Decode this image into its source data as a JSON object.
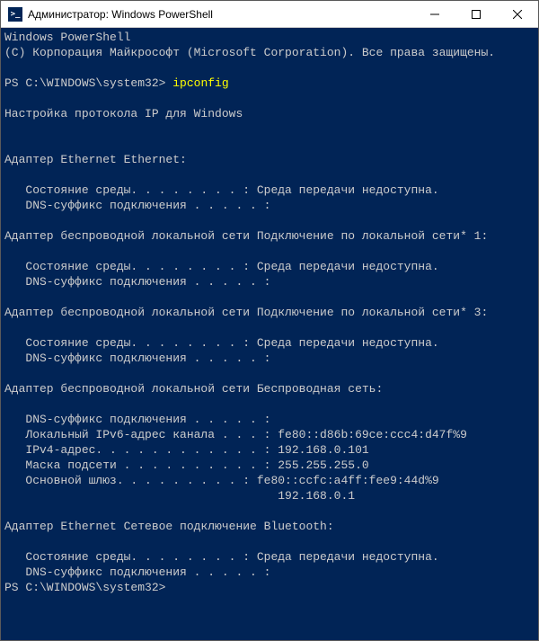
{
  "titlebar": {
    "icon_glyph": ">_",
    "title": "Администратор: Windows PowerShell",
    "minimize_label": "Minimize",
    "maximize_label": "Maximize",
    "close_label": "Close"
  },
  "terminal": {
    "header1": "Windows PowerShell",
    "header2": "(С) Корпорация Майкрософт (Microsoft Corporation). Все права защищены.",
    "prompt_prefix": "PS C:\\WINDOWS\\system32>",
    "command": "ipconfig",
    "config_title": "Настройка протокола IP для Windows",
    "adapters": [
      {
        "name": "Адаптер Ethernet Ethernet:",
        "rows": [
          {
            "label": "   Состояние среды. . . . . . . . :",
            "value": " Среда передачи недоступна."
          },
          {
            "label": "   DNS-суффикс подключения . . . . . :",
            "value": ""
          }
        ]
      },
      {
        "name": "Адаптер беспроводной локальной сети Подключение по локальной сети* 1:",
        "rows": [
          {
            "label": "   Состояние среды. . . . . . . . :",
            "value": " Среда передачи недоступна."
          },
          {
            "label": "   DNS-суффикс подключения . . . . . :",
            "value": ""
          }
        ]
      },
      {
        "name": "Адаптер беспроводной локальной сети Подключение по локальной сети* 3:",
        "rows": [
          {
            "label": "   Состояние среды. . . . . . . . :",
            "value": " Среда передачи недоступна."
          },
          {
            "label": "   DNS-суффикс подключения . . . . . :",
            "value": ""
          }
        ]
      },
      {
        "name": "Адаптер беспроводной локальной сети Беспроводная сеть:",
        "rows": [
          {
            "label": "   DNS-суффикс подключения . . . . . :",
            "value": ""
          },
          {
            "label": "   Локальный IPv6-адрес канала . . . :",
            "value": " fe80::d86b:69ce:ccc4:d47f%9"
          },
          {
            "label": "   IPv4-адрес. . . . . . . . . . . . :",
            "value": " 192.168.0.101"
          },
          {
            "label": "   Маска подсети . . . . . . . . . . :",
            "value": " 255.255.255.0"
          },
          {
            "label": "   Основной шлюз. . . . . . . . . :",
            "value": " fe80::ccfc:a4ff:fee9:44d%9"
          },
          {
            "label": "                                     ",
            "value": "  192.168.0.1"
          }
        ]
      },
      {
        "name": "Адаптер Ethernet Сетевое подключение Bluetooth:",
        "rows": [
          {
            "label": "   Состояние среды. . . . . . . . :",
            "value": " Среда передачи недоступна."
          },
          {
            "label": "   DNS-суффикс подключения . . . . . :",
            "value": ""
          }
        ]
      }
    ],
    "final_prompt": "PS C:\\WINDOWS\\system32>"
  }
}
